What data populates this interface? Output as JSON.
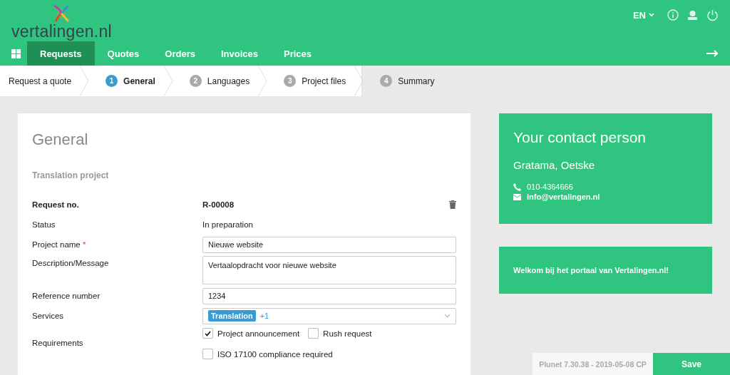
{
  "header": {
    "logo_text": "vertalingen.nl",
    "language": "EN"
  },
  "nav": [
    {
      "label": "Requests",
      "selected": true
    },
    {
      "label": "Quotes",
      "selected": false
    },
    {
      "label": "Orders",
      "selected": false
    },
    {
      "label": "Invoices",
      "selected": false
    },
    {
      "label": "Prices",
      "selected": false
    }
  ],
  "breadcrumb": {
    "title": "Request a quote",
    "steps": [
      {
        "number": "1",
        "label": "General",
        "selected": true
      },
      {
        "number": "2",
        "label": "Languages",
        "selected": false
      },
      {
        "number": "3",
        "label": "Project files",
        "selected": false
      },
      {
        "number": "4",
        "label": "Summary",
        "selected": false
      }
    ]
  },
  "form": {
    "title": "General",
    "section": "Translation project",
    "rows": [
      {
        "kind": "id",
        "label": "Request no.",
        "value": "R-00008"
      },
      {
        "kind": "text",
        "label": "Status",
        "value": "In preparation"
      },
      {
        "kind": "input",
        "label": "Project name",
        "required": true,
        "required_mark": "*",
        "value": "Nieuwe website"
      },
      {
        "kind": "textarea",
        "label": "Description/Message",
        "value": "Vertaalopdracht voor nieuwe website"
      },
      {
        "kind": "input",
        "label": "Reference number",
        "value": "1234"
      },
      {
        "kind": "select",
        "label": "Services",
        "tags": [
          "Translation"
        ],
        "more": "+1"
      },
      {
        "kind": "checkboxes",
        "label": "Requirements",
        "options": [
          {
            "label": "Project announcement",
            "checked": true
          },
          {
            "label": "Rush request",
            "checked": false
          },
          {
            "label": "ISO 17100 compliance required",
            "checked": false
          }
        ]
      }
    ]
  },
  "contact": {
    "title": "Your contact person",
    "name": "Gratama, Oetske",
    "phone": "010-4364666",
    "email": "info@vertalingen.nl"
  },
  "welcome": "Welkom bij het portaal van Vertalingen.nl!",
  "footer": {
    "version": "Plunet 7.30.38 - 2019-05-08 CP",
    "save": "Save"
  }
}
